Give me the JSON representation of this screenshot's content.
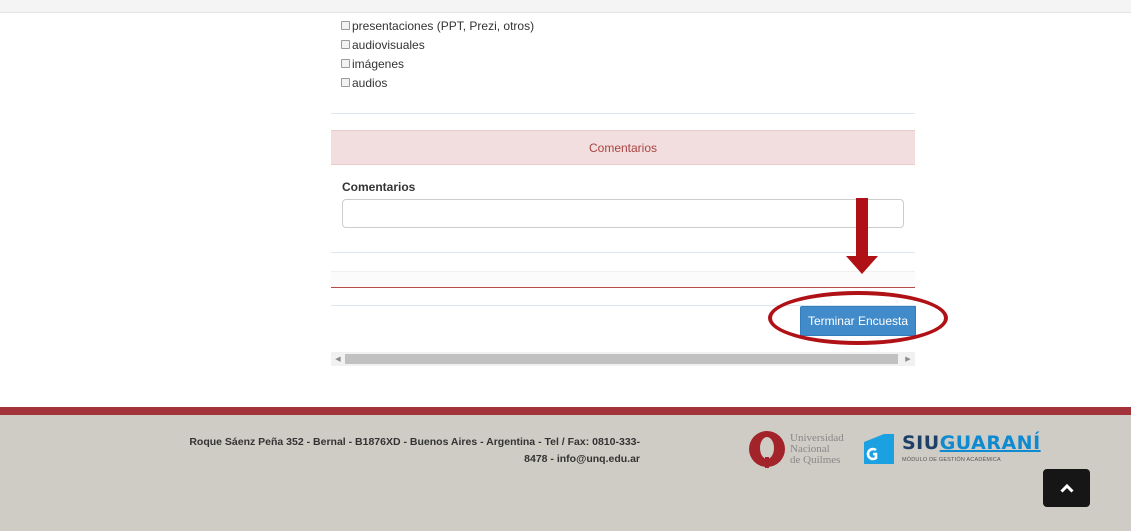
{
  "options": [
    {
      "label": "presentaciones (PPT, Prezi, otros)",
      "checked": false
    },
    {
      "label": "audiovisuales",
      "checked": false
    },
    {
      "label": "imágenes",
      "checked": false
    },
    {
      "label": "audios",
      "checked": false
    }
  ],
  "comments_section": {
    "title": "Comentarios",
    "field_label": "Comentarios",
    "field_value": ""
  },
  "actions": {
    "finish_label": "Terminar Encuesta"
  },
  "footer": {
    "address_line1": "Roque Sáenz Peña 352 - Bernal - B1876XD - Buenos Aires - Argentina - Tel / Fax: 0810-333-",
    "address_line2": "8478 - info@unq.edu.ar",
    "unq": {
      "line1": "Universidad",
      "line2": "Nacional",
      "line3": "de Quilmes"
    },
    "siu": {
      "brand_siu": "SIU",
      "brand_guarani": "GUARANÍ",
      "subtitle": "MÓDULO DE GESTIÓN ACADÉMICA"
    }
  },
  "colors": {
    "section_head_bg": "#f2dede",
    "section_head_text": "#a94442",
    "primary_button": "#428bca",
    "footer_band": "#a3323b",
    "footer_bg": "#cfccc5",
    "annotation": "#b01116"
  },
  "icons": {
    "scroll_left": "triangle-left",
    "scroll_right": "triangle-right",
    "back_to_top": "chevron-up"
  }
}
